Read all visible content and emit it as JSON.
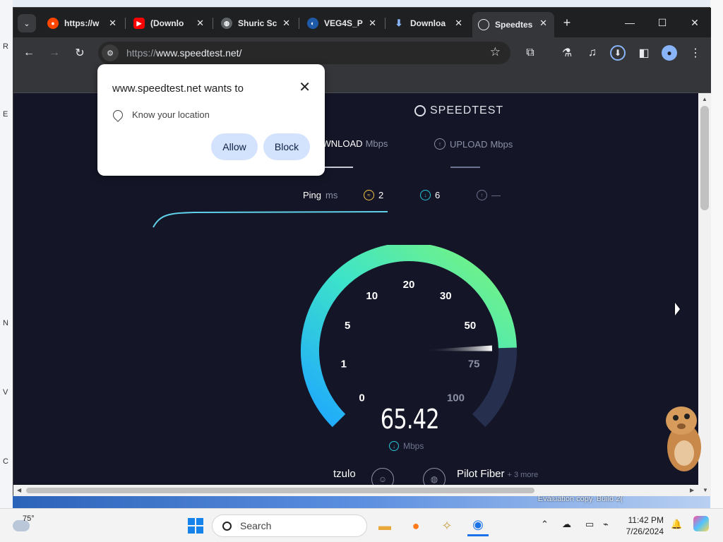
{
  "tabs": [
    {
      "title": "https://w",
      "favicon": "reddit-icon",
      "color": "#ff4500"
    },
    {
      "title": "(Downlo",
      "favicon": "youtube-icon",
      "color": "#ff0000"
    },
    {
      "title": "Shuric Sc",
      "favicon": "globe-icon",
      "color": "#9aa0a6"
    },
    {
      "title": "VEG4S_P",
      "favicon": "vegas-icon",
      "color": "#4aa3ff"
    },
    {
      "title": "Downloa",
      "favicon": "download-icon",
      "color": "#8ab4f8"
    },
    {
      "title": "Speedtes",
      "favicon": "speedtest-icon",
      "color": "#e8eaed"
    }
  ],
  "window": {
    "minimize": "—",
    "maximize": "☐",
    "close": "✕"
  },
  "address": {
    "protocol": "https://",
    "host": "www.speedtest.net/"
  },
  "popup": {
    "title": "www.speedtest.net wants to",
    "permission": "Know your location",
    "allow": "Allow",
    "block": "Block"
  },
  "speedtest": {
    "logo": "SPEEDTEST",
    "download_label": "DOWNLOAD",
    "download_unit": "Mbps",
    "upload_label": "UPLOAD",
    "upload_unit": "Mbps",
    "ping_label": "Ping",
    "ping_unit": "ms",
    "ping_value": "2",
    "download_ping": "6",
    "upload_ping": "—",
    "speed": "65.42",
    "speed_unit": "Mbps",
    "gauge_ticks": [
      "0",
      "1",
      "5",
      "10",
      "20",
      "30",
      "50",
      "75",
      "100"
    ],
    "gauge_needle_value": 65.42,
    "server_user": "tzulo",
    "provider": "Pilot Fiber",
    "provider_more": "+ 3 more"
  },
  "desktop": {
    "evaluation": "Evaluation copy. Build 2("
  },
  "taskbar": {
    "weather_temp": "75°",
    "search": "Search",
    "time": "11:42 PM",
    "date": "7/26/2024"
  }
}
